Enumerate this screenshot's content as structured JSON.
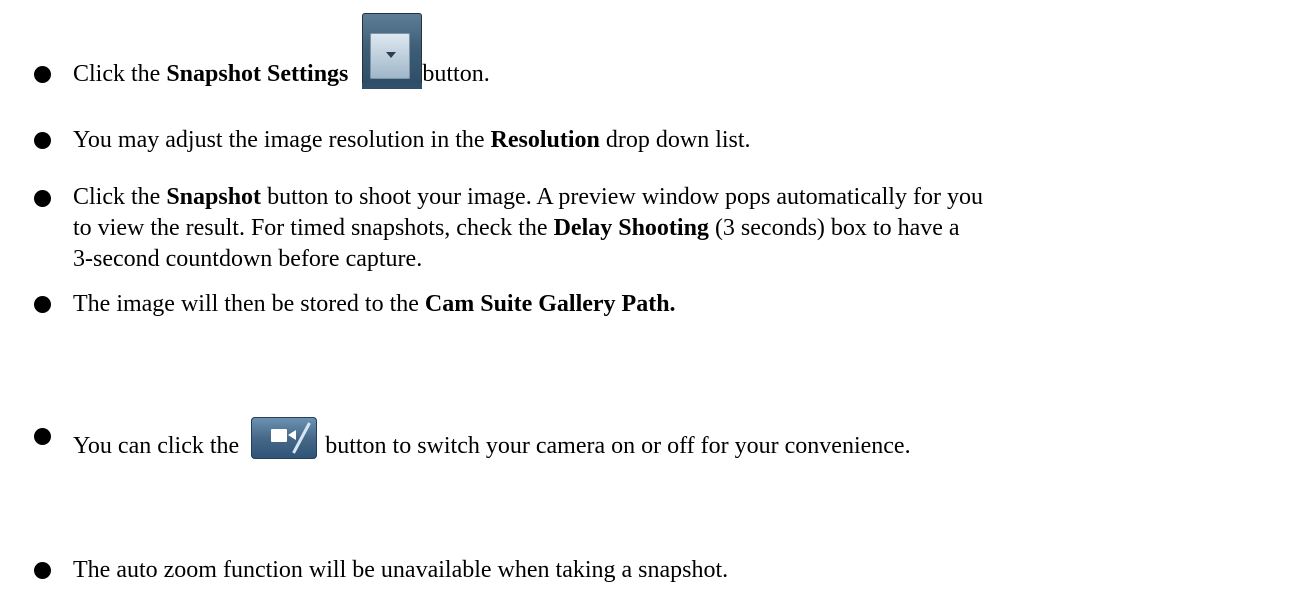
{
  "items": [
    {
      "before": "Click the ",
      "bold": "Snapshot Settings",
      "after": "button.",
      "icon": "snapshot-settings-button-icon"
    },
    {
      "before": "You may adjust the image resolution in the ",
      "bold": "Resolution",
      "after": " drop down list."
    },
    {
      "line1_before": "Click the ",
      "line1_bold": "Snapshot",
      "line1_after": " button to shoot your image. A preview window pops automatically for you",
      "line2_before": "to view the result. For timed snapshots, check the ",
      "line2_bold": "Delay Shooting",
      "line2_after": " (3 seconds) box to have a",
      "line3": "3-second countdown before capture."
    },
    {
      "before": "The image will then be stored to the ",
      "bold": "Cam Suite Gallery Path."
    },
    {
      "before": "You can click the ",
      "after": "button to switch your camera on or off for your convenience.",
      "icon": "camera-toggle-button-icon"
    },
    {
      "text": "The auto zoom function will be unavailable when taking a snapshot."
    }
  ]
}
